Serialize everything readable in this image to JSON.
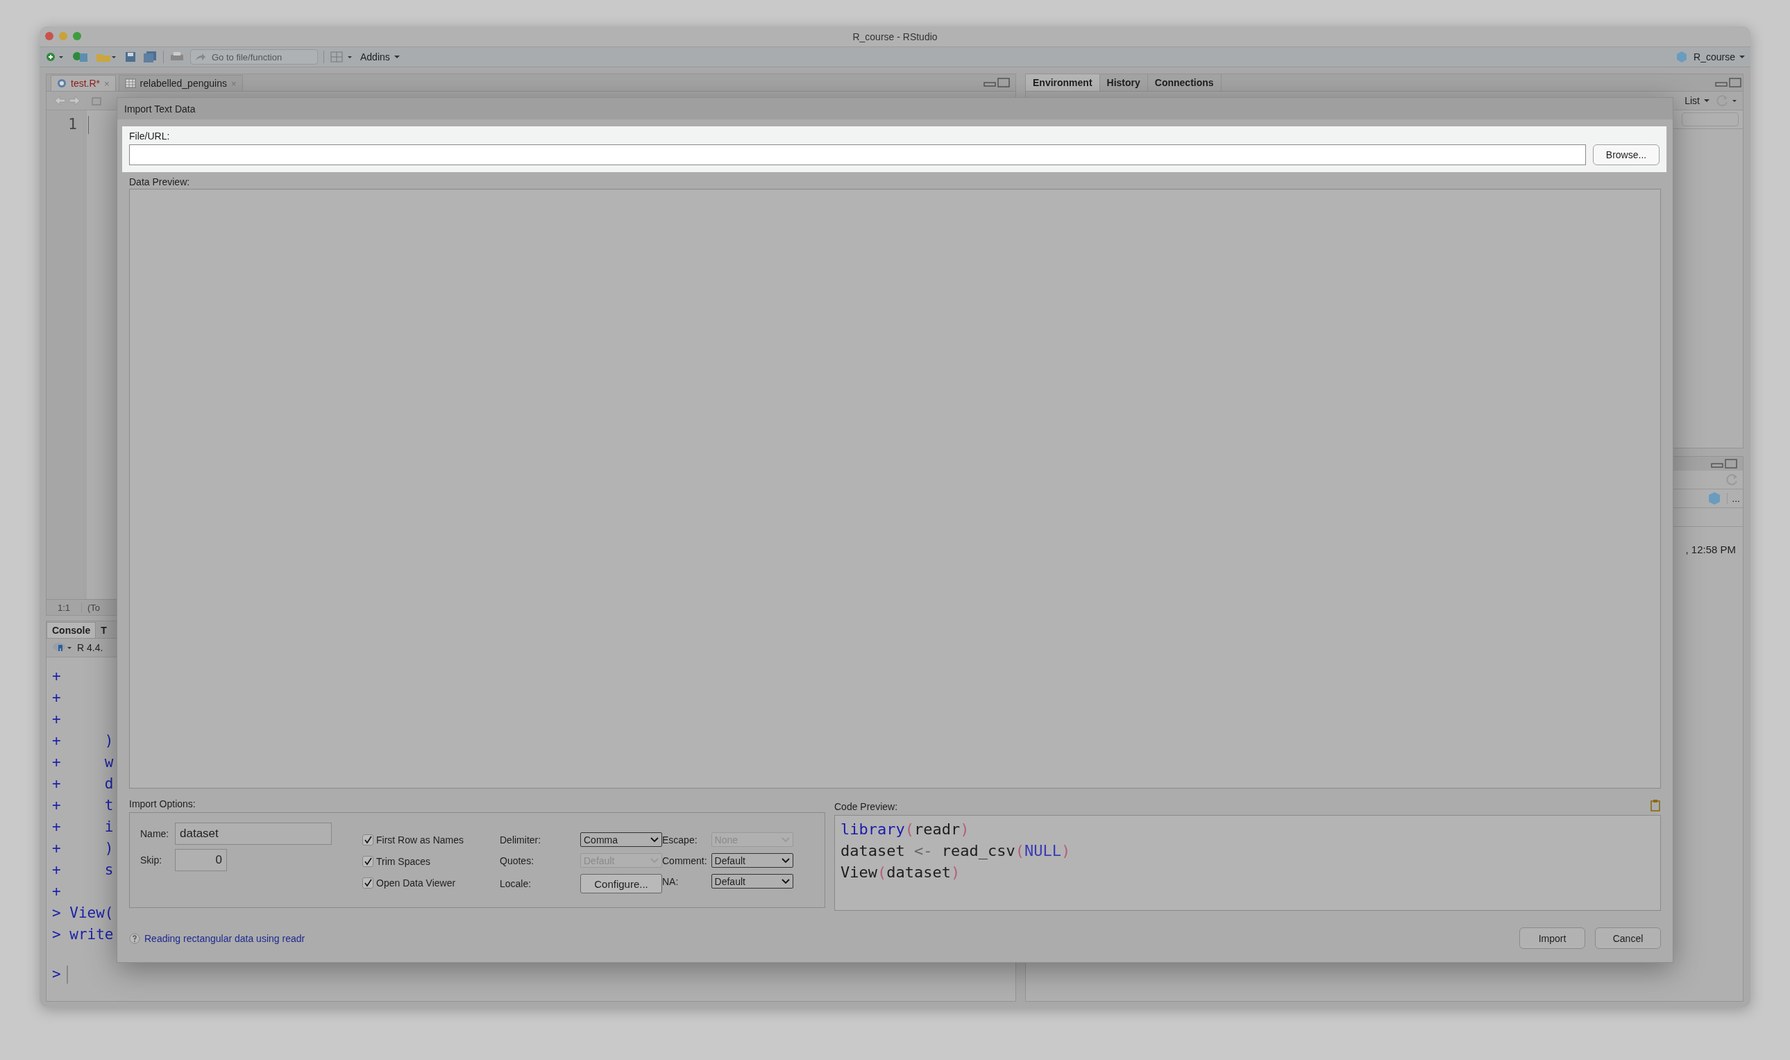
{
  "window": {
    "title": "R_course - RStudio"
  },
  "toolbar": {
    "go_to": {
      "placeholder": "Go to file/function"
    },
    "addins": "Addins",
    "project": "R_course"
  },
  "editor": {
    "tabs": [
      {
        "label": "test.R*",
        "kind": "script",
        "selected": true,
        "modified": true,
        "close": "×"
      },
      {
        "label": "relabelled_penguins",
        "kind": "data",
        "selected": false,
        "modified": false,
        "close": "×"
      }
    ],
    "line_numbers": [
      "1"
    ],
    "cursor_position": "1:1",
    "scope": "(To"
  },
  "console": {
    "tabs": [
      {
        "label": "Console",
        "selected": true
      },
      {
        "label": "T",
        "selected": false
      }
    ],
    "r_version": "R 4.4.",
    "lines": [
      "+",
      "+",
      "+",
      "+     )",
      "+     w",
      "+     d",
      "+     t",
      "+     i",
      "+     )",
      "+     s",
      "+",
      "> View(",
      "> write"
    ],
    "prompt": ">"
  },
  "environment_pane": {
    "tabs": [
      {
        "label": "Environment",
        "selected": true
      },
      {
        "label": "History",
        "selected": false
      },
      {
        "label": "Connections",
        "selected": false
      }
    ],
    "view_menu": "List"
  },
  "files_pane": {
    "more": "...",
    "timestamp": ", 12:58 PM"
  },
  "dialog": {
    "title": "Import Text Data",
    "file_label": "File/URL:",
    "browse_button": "Browse...",
    "preview_label": "Data Preview:",
    "options_label": "Import Options:",
    "name": {
      "label": "Name:",
      "value": "dataset"
    },
    "skip": {
      "label": "Skip:",
      "value": "0"
    },
    "checkboxes": [
      {
        "label": "First Row as Names",
        "checked": true
      },
      {
        "label": "Trim Spaces",
        "checked": true
      },
      {
        "label": "Open Data Viewer",
        "checked": true
      }
    ],
    "selects": [
      {
        "label": "Delimiter:",
        "value": "Comma",
        "kind": "select",
        "disabled": false
      },
      {
        "label": "Quotes:",
        "value": "Default",
        "kind": "select",
        "disabled": true
      },
      {
        "label": "Locale:",
        "value": "Configure...",
        "kind": "button"
      },
      {
        "label": "Escape:",
        "value": "None",
        "kind": "select",
        "disabled": true
      },
      {
        "label": "Comment:",
        "value": "Default",
        "kind": "select",
        "disabled": false
      },
      {
        "label": "NA:",
        "value": "Default",
        "kind": "select",
        "disabled": false
      }
    ],
    "code_label": "Code Preview:",
    "code_lines": [
      [
        {
          "kind": "function",
          "text": "library"
        },
        {
          "kind": "paren",
          "text": "("
        },
        {
          "kind": "plain",
          "text": "readr"
        },
        {
          "kind": "paren",
          "text": ")"
        }
      ],
      [
        {
          "kind": "plain",
          "text": "dataset "
        },
        {
          "kind": "operator",
          "text": "<-"
        },
        {
          "kind": "plain",
          "text": " read_csv"
        },
        {
          "kind": "paren",
          "text": "("
        },
        {
          "kind": "constant",
          "text": "NULL"
        },
        {
          "kind": "paren",
          "text": ")"
        }
      ],
      [
        {
          "kind": "plain",
          "text": "View"
        },
        {
          "kind": "paren",
          "text": "("
        },
        {
          "kind": "plain",
          "text": "dataset"
        },
        {
          "kind": "paren",
          "text": ")"
        }
      ]
    ],
    "help_link": "Reading rectangular data using readr",
    "buttons": [
      "Import",
      "Cancel"
    ]
  }
}
